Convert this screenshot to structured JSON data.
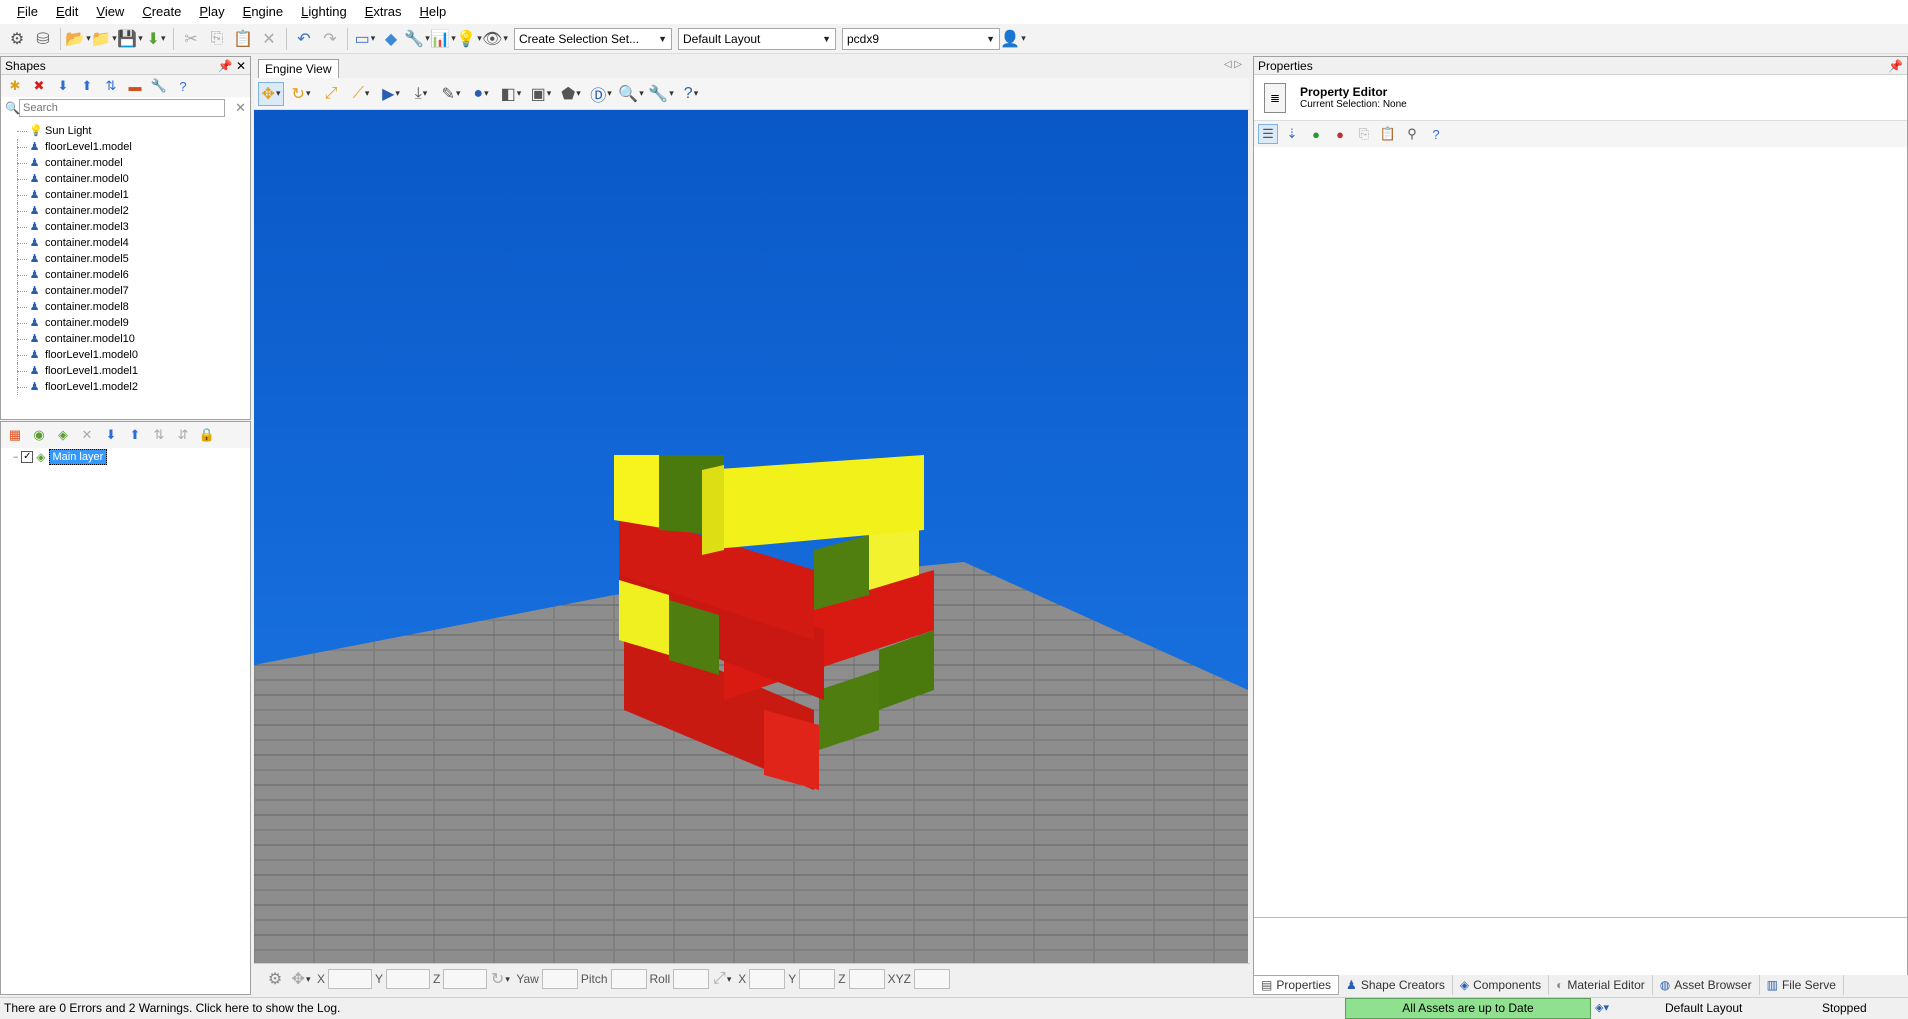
{
  "menu": [
    "File",
    "Edit",
    "View",
    "Create",
    "Play",
    "Engine",
    "Lighting",
    "Extras",
    "Help"
  ],
  "toolbar": {
    "selection_set": "Create Selection Set...",
    "layout": "Default Layout",
    "profile": "pcdx9"
  },
  "shapes_panel": {
    "title": "Shapes",
    "search_placeholder": "Search",
    "items": [
      "Sun Light",
      "floorLevel1.model",
      "container.model",
      "container.model0",
      "container.model1",
      "container.model2",
      "container.model3",
      "container.model4",
      "container.model5",
      "container.model6",
      "container.model7",
      "container.model8",
      "container.model9",
      "container.model10",
      "floorLevel1.model0",
      "floorLevel1.model1",
      "floorLevel1.model2"
    ]
  },
  "layers_panel": {
    "items": [
      "Main layer"
    ]
  },
  "engine_view": {
    "tab": "Engine View",
    "coords": {
      "x": "X",
      "y": "Y",
      "z": "Z",
      "yaw": "Yaw",
      "pitch": "Pitch",
      "roll": "Roll",
      "x2": "X",
      "y2": "Y",
      "z2": "Z",
      "xyz": "XYZ"
    }
  },
  "properties_panel": {
    "title": "Properties",
    "editor_title": "Property Editor",
    "selection": "Current Selection: None"
  },
  "bottom_tabs": [
    "Properties",
    "Shape Creators",
    "Components",
    "Material Editor",
    "Asset Browser",
    "File Serve"
  ],
  "status": {
    "log": "There are 0 Errors and 2 Warnings. Click here to show the Log.",
    "assets": "All Assets are up to Date",
    "layout": "Default Layout",
    "state": "Stopped"
  },
  "colors": {
    "sky": "#1468d4",
    "container_yellow": "#f2f21a",
    "container_red": "#d81a12",
    "container_green": "#4a7a0e",
    "status_green": "#8fe08f"
  }
}
